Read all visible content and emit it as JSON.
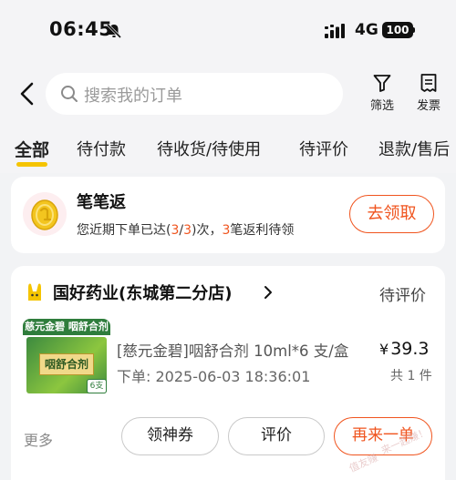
{
  "status_bar": {
    "time": "06:45",
    "network": "4G",
    "battery": "100",
    "icons": [
      "bell-muted-icon",
      "signal-icon",
      "battery-icon"
    ]
  },
  "header": {
    "search_placeholder": "搜索我的订单",
    "filter_label": "筛选",
    "invoice_label": "发票"
  },
  "tabs": [
    {
      "label": "全部",
      "active": true
    },
    {
      "label": "待付款",
      "active": false
    },
    {
      "label": "待收货/待使用",
      "active": false
    },
    {
      "label": "待评价",
      "active": false
    },
    {
      "label": "退款/售后",
      "active": false
    }
  ],
  "rebate": {
    "title": "笔笔返",
    "desc_prefix": "您近期下单已达(",
    "count_done": "3",
    "slash": "/",
    "count_total": "3",
    "desc_middle": ")次，",
    "pending_count": "3",
    "desc_suffix": "笔返利待领",
    "claim_label": "去领取"
  },
  "order": {
    "store_name": "国好药业(东城第二分店)",
    "status": "待评价",
    "product_banner": "慈元金碧 咽舒合剂",
    "product_box_text": "咽舒合剂",
    "product_badge": "6支",
    "product_title": "[慈元金碧]咽舒合剂 10ml*6 支/盒",
    "order_time": "下单: 2025-06-03 18:36:01",
    "price_symbol": "¥",
    "price": "39.3",
    "quantity": "共 1 件",
    "more_label": "更多",
    "coupon_label": "领神券",
    "review_label": "评价",
    "reorder_label": "再来一单"
  },
  "watermark": {
    "line1": "来一起赚！",
    "line2": "值友赚"
  },
  "colors": {
    "accent_orange": "#f0541e",
    "tab_underline": "#f5c400",
    "background": "#f2f3f5"
  }
}
